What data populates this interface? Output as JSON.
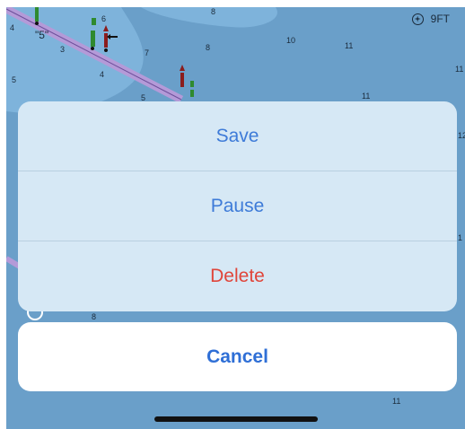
{
  "status": {
    "depth_label": "9FT",
    "icon": "compass-rose-icon"
  },
  "map": {
    "depths": [
      "4",
      "\"5\"",
      "3",
      "6",
      "7",
      "4",
      "8",
      "10",
      "11",
      "5",
      "11",
      "11",
      "5",
      "12",
      "1",
      "8",
      "8",
      "11"
    ]
  },
  "action_sheet": {
    "save_label": "Save",
    "pause_label": "Pause",
    "delete_label": "Delete",
    "cancel_label": "Cancel"
  },
  "colors": {
    "accent": "#3e7bd8",
    "destructive": "#e0453a",
    "sheet_bg": "#d6e8f5",
    "water": "#6a9fc9"
  }
}
